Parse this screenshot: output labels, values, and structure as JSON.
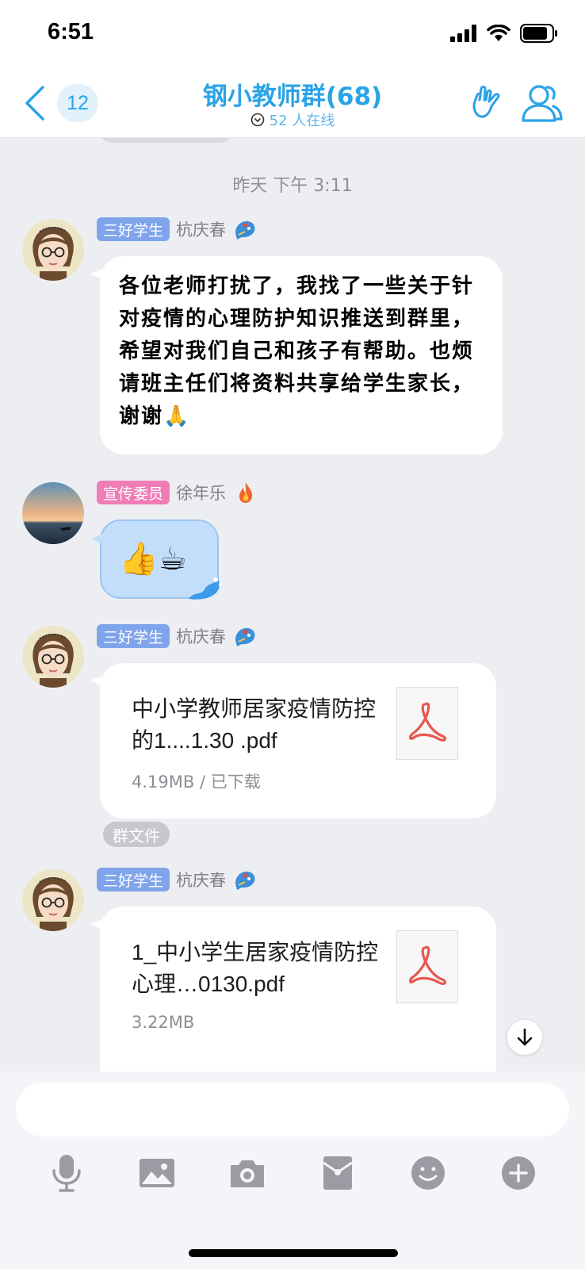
{
  "status_bar": {
    "time": "6:51"
  },
  "header": {
    "unread_count": "12",
    "group_title": "钢小教师群(68)",
    "online_text": "52 人在线"
  },
  "chat": {
    "timestamp": "昨天 下午 3:11",
    "messages": [
      {
        "badge": "三好学生",
        "sender": "杭庆春",
        "text": "各位老师打扰了，我找了一些关于针对疫情的心理防护知识推送到群里，希望对我们自己和孩子有帮助。也烦请班主任们将资料共享给学生家长，谢谢🙏"
      },
      {
        "badge": "宣传委员",
        "sender": "徐年乐",
        "emoji": "👍☕"
      },
      {
        "badge": "三好学生",
        "sender": "杭庆春",
        "file_name": "中小学教师居家疫情防控的1....1.30 .pdf",
        "file_meta": "4.19MB / 已下载",
        "tag": "群文件"
      },
      {
        "badge": "三好学生",
        "sender": "杭庆春",
        "file_name": "1_中小学生居家疫情防控心理…0130.pdf",
        "file_meta": "3.22MB"
      }
    ]
  },
  "input": {
    "placeholder": ""
  },
  "toolbar_icons": [
    "microphone-icon",
    "image-icon",
    "camera-icon",
    "red-packet-icon",
    "emoji-icon",
    "plus-icon"
  ],
  "colors": {
    "accent": "#2aa3e7",
    "badge_blue": "#7fa4eb",
    "badge_pink": "#f07cb7",
    "chat_bg": "#edeef2",
    "pdf_red": "#e8574f"
  }
}
